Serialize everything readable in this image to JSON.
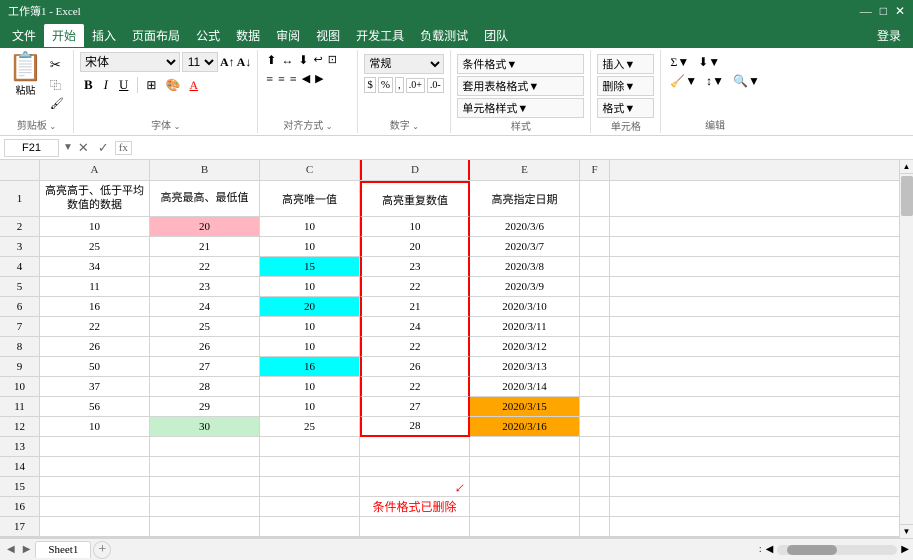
{
  "titleBar": {
    "text": "工作簿1 - Excel",
    "controls": [
      "—",
      "□",
      "✕"
    ]
  },
  "menuBar": {
    "items": [
      "文件",
      "开始",
      "插入",
      "页面布局",
      "公式",
      "数据",
      "审阅",
      "视图",
      "开发工具",
      "负载测试",
      "团队"
    ],
    "activeIndex": 1,
    "loginLabel": "登录"
  },
  "ribbon": {
    "clipboard": {
      "label": "剪贴板",
      "paste": "粘贴",
      "cut": "✂",
      "copy": "⿻",
      "formatpaint": "🖌"
    },
    "font": {
      "label": "字体",
      "name": "宋体",
      "size": "11",
      "growIcon": "A↑",
      "shrinkIcon": "A↓",
      "bold": "B",
      "italic": "I",
      "underline": "U",
      "border": "⊞",
      "fill": "🎨",
      "fontColor": "A"
    },
    "alignment": {
      "label": "对齐方式"
    },
    "number": {
      "label": "数字",
      "format": "常规"
    },
    "styles": {
      "label": "样式",
      "conditional": "条件格式▼",
      "tableStyle": "套用表格格式▼",
      "cellStyle": "单元格样式▼"
    },
    "cells": {
      "label": "单元格",
      "insert": "插入▼",
      "delete": "删除▼",
      "format": "格式▼"
    },
    "editing": {
      "label": "编辑",
      "sum": "Σ▼",
      "fill": "⬇▼",
      "clear": "🧹▼",
      "sort": "↕▼",
      "find": "🔍▼"
    }
  },
  "formulaBar": {
    "cellRef": "F21",
    "formula": ""
  },
  "columns": [
    {
      "label": "A",
      "class": "col-a"
    },
    {
      "label": "B",
      "class": "col-b"
    },
    {
      "label": "C",
      "class": "col-c"
    },
    {
      "label": "D",
      "class": "col-d"
    },
    {
      "label": "E",
      "class": "col-e"
    },
    {
      "label": "F",
      "class": "col-f"
    }
  ],
  "rows": [
    {
      "rowNum": "1",
      "heightClass": "row-h1",
      "cells": [
        {
          "value": "高亮高于、低于平均数值的数据",
          "bg": "",
          "colClass": "col-a"
        },
        {
          "value": "高亮最高、最低值",
          "bg": "",
          "colClass": "col-b"
        },
        {
          "value": "高亮唯一值",
          "bg": "",
          "colClass": "col-c"
        },
        {
          "value": "高亮重复数值",
          "bg": "",
          "colClass": "col-d",
          "dBorder": true
        },
        {
          "value": "高亮指定日期",
          "bg": "",
          "colClass": "col-e"
        },
        {
          "value": "",
          "bg": "",
          "colClass": "col-f"
        }
      ]
    },
    {
      "rowNum": "2",
      "heightClass": "row-h",
      "cells": [
        {
          "value": "10",
          "bg": "",
          "colClass": "col-a"
        },
        {
          "value": "20",
          "bg": "bg-pink",
          "colClass": "col-b"
        },
        {
          "value": "10",
          "bg": "",
          "colClass": "col-c"
        },
        {
          "value": "10",
          "bg": "",
          "colClass": "col-d",
          "dBorder": true
        },
        {
          "value": "2020/3/6",
          "bg": "",
          "colClass": "col-e"
        },
        {
          "value": "",
          "bg": "",
          "colClass": "col-f"
        }
      ]
    },
    {
      "rowNum": "3",
      "heightClass": "row-h",
      "cells": [
        {
          "value": "25",
          "bg": "",
          "colClass": "col-a"
        },
        {
          "value": "21",
          "bg": "",
          "colClass": "col-b"
        },
        {
          "value": "10",
          "bg": "",
          "colClass": "col-c"
        },
        {
          "value": "20",
          "bg": "",
          "colClass": "col-d",
          "dBorder": true
        },
        {
          "value": "2020/3/7",
          "bg": "",
          "colClass": "col-e"
        },
        {
          "value": "",
          "bg": "",
          "colClass": "col-f"
        }
      ]
    },
    {
      "rowNum": "4",
      "heightClass": "row-h",
      "cells": [
        {
          "value": "34",
          "bg": "",
          "colClass": "col-a"
        },
        {
          "value": "22",
          "bg": "",
          "colClass": "col-b"
        },
        {
          "value": "15",
          "bg": "bg-cyan",
          "colClass": "col-c"
        },
        {
          "value": "23",
          "bg": "",
          "colClass": "col-d",
          "dBorder": true
        },
        {
          "value": "2020/3/8",
          "bg": "",
          "colClass": "col-e"
        },
        {
          "value": "",
          "bg": "",
          "colClass": "col-f"
        }
      ]
    },
    {
      "rowNum": "5",
      "heightClass": "row-h",
      "cells": [
        {
          "value": "11",
          "bg": "",
          "colClass": "col-a"
        },
        {
          "value": "23",
          "bg": "",
          "colClass": "col-b"
        },
        {
          "value": "10",
          "bg": "",
          "colClass": "col-c"
        },
        {
          "value": "22",
          "bg": "",
          "colClass": "col-d",
          "dBorder": true
        },
        {
          "value": "2020/3/9",
          "bg": "",
          "colClass": "col-e"
        },
        {
          "value": "",
          "bg": "",
          "colClass": "col-f"
        }
      ]
    },
    {
      "rowNum": "6",
      "heightClass": "row-h",
      "cells": [
        {
          "value": "16",
          "bg": "",
          "colClass": "col-a"
        },
        {
          "value": "24",
          "bg": "",
          "colClass": "col-b"
        },
        {
          "value": "20",
          "bg": "bg-cyan",
          "colClass": "col-c"
        },
        {
          "value": "21",
          "bg": "",
          "colClass": "col-d",
          "dBorder": true
        },
        {
          "value": "2020/3/10",
          "bg": "",
          "colClass": "col-e"
        },
        {
          "value": "",
          "bg": "",
          "colClass": "col-f"
        }
      ]
    },
    {
      "rowNum": "7",
      "heightClass": "row-h",
      "cells": [
        {
          "value": "22",
          "bg": "",
          "colClass": "col-a"
        },
        {
          "value": "25",
          "bg": "",
          "colClass": "col-b"
        },
        {
          "value": "10",
          "bg": "",
          "colClass": "col-c"
        },
        {
          "value": "24",
          "bg": "",
          "colClass": "col-d",
          "dBorder": true
        },
        {
          "value": "2020/3/11",
          "bg": "",
          "colClass": "col-e"
        },
        {
          "value": "",
          "bg": "",
          "colClass": "col-f"
        }
      ]
    },
    {
      "rowNum": "8",
      "heightClass": "row-h",
      "cells": [
        {
          "value": "26",
          "bg": "",
          "colClass": "col-a"
        },
        {
          "value": "26",
          "bg": "",
          "colClass": "col-b"
        },
        {
          "value": "10",
          "bg": "",
          "colClass": "col-c"
        },
        {
          "value": "22",
          "bg": "",
          "colClass": "col-d",
          "dBorder": true
        },
        {
          "value": "2020/3/12",
          "bg": "",
          "colClass": "col-e"
        },
        {
          "value": "",
          "bg": "",
          "colClass": "col-f"
        }
      ]
    },
    {
      "rowNum": "9",
      "heightClass": "row-h",
      "cells": [
        {
          "value": "50",
          "bg": "",
          "colClass": "col-a"
        },
        {
          "value": "27",
          "bg": "",
          "colClass": "col-b"
        },
        {
          "value": "16",
          "bg": "bg-cyan",
          "colClass": "col-c"
        },
        {
          "value": "26",
          "bg": "",
          "colClass": "col-d",
          "dBorder": true
        },
        {
          "value": "2020/3/13",
          "bg": "",
          "colClass": "col-e"
        },
        {
          "value": "",
          "bg": "",
          "colClass": "col-f"
        }
      ]
    },
    {
      "rowNum": "10",
      "heightClass": "row-h",
      "cells": [
        {
          "value": "37",
          "bg": "",
          "colClass": "col-a"
        },
        {
          "value": "28",
          "bg": "",
          "colClass": "col-b"
        },
        {
          "value": "10",
          "bg": "",
          "colClass": "col-c"
        },
        {
          "value": "22",
          "bg": "",
          "colClass": "col-d",
          "dBorder": true
        },
        {
          "value": "2020/3/14",
          "bg": "",
          "colClass": "col-e"
        },
        {
          "value": "",
          "bg": "",
          "colClass": "col-f"
        }
      ]
    },
    {
      "rowNum": "11",
      "heightClass": "row-h",
      "cells": [
        {
          "value": "56",
          "bg": "",
          "colClass": "col-a"
        },
        {
          "value": "29",
          "bg": "",
          "colClass": "col-b"
        },
        {
          "value": "10",
          "bg": "",
          "colClass": "col-c"
        },
        {
          "value": "27",
          "bg": "",
          "colClass": "col-d",
          "dBorder": true
        },
        {
          "value": "2020/3/15",
          "bg": "bg-orange",
          "colClass": "col-e"
        },
        {
          "value": "",
          "bg": "",
          "colClass": "col-f"
        }
      ]
    },
    {
      "rowNum": "12",
      "heightClass": "row-h",
      "cells": [
        {
          "value": "10",
          "bg": "",
          "colClass": "col-a"
        },
        {
          "value": "30",
          "bg": "bg-light-green",
          "colClass": "col-b"
        },
        {
          "value": "25",
          "bg": "",
          "colClass": "col-c"
        },
        {
          "value": "28",
          "bg": "",
          "colClass": "col-d",
          "dBorder": true
        },
        {
          "value": "2020/3/16",
          "bg": "bg-orange",
          "colClass": "col-e"
        },
        {
          "value": "",
          "bg": "",
          "colClass": "col-f"
        }
      ]
    },
    {
      "rowNum": "13",
      "heightClass": "row-h",
      "cells": [
        {
          "value": "",
          "bg": "",
          "colClass": "col-a"
        },
        {
          "value": "",
          "bg": "",
          "colClass": "col-b"
        },
        {
          "value": "",
          "bg": "",
          "colClass": "col-c"
        },
        {
          "value": "",
          "bg": "",
          "colClass": "col-d",
          "dBorder": true
        },
        {
          "value": "",
          "bg": "",
          "colClass": "col-e"
        },
        {
          "value": "",
          "bg": "",
          "colClass": "col-f"
        }
      ]
    },
    {
      "rowNum": "14",
      "heightClass": "row-h",
      "cells": [
        {
          "value": "",
          "bg": "",
          "colClass": "col-a"
        },
        {
          "value": "",
          "bg": "",
          "colClass": "col-b"
        },
        {
          "value": "",
          "bg": "",
          "colClass": "col-c"
        },
        {
          "value": "",
          "bg": "",
          "colClass": "col-d"
        },
        {
          "value": "",
          "bg": "",
          "colClass": "col-e"
        },
        {
          "value": "",
          "bg": "",
          "colClass": "col-f"
        }
      ]
    },
    {
      "rowNum": "15",
      "heightClass": "row-h",
      "cells": [
        {
          "value": "",
          "bg": "",
          "colClass": "col-a"
        },
        {
          "value": "",
          "bg": "",
          "colClass": "col-b"
        },
        {
          "value": "",
          "bg": "",
          "colClass": "col-c"
        },
        {
          "value": "",
          "bg": "",
          "colClass": "col-d"
        },
        {
          "value": "",
          "bg": "",
          "colClass": "col-e"
        },
        {
          "value": "",
          "bg": "",
          "colClass": "col-f"
        }
      ]
    },
    {
      "rowNum": "16",
      "heightClass": "row-h",
      "cells": [
        {
          "value": "",
          "bg": "",
          "colClass": "col-a"
        },
        {
          "value": "",
          "bg": "",
          "colClass": "col-b"
        },
        {
          "value": "",
          "bg": "",
          "colClass": "col-c"
        },
        {
          "value": "",
          "bg": "",
          "colClass": "col-d"
        },
        {
          "value": "",
          "bg": "",
          "colClass": "col-e"
        },
        {
          "value": "",
          "bg": "",
          "colClass": "col-f"
        }
      ]
    },
    {
      "rowNum": "17",
      "heightClass": "row-h",
      "cells": [
        {
          "value": "",
          "bg": "",
          "colClass": "col-a"
        },
        {
          "value": "",
          "bg": "",
          "colClass": "col-b"
        },
        {
          "value": "",
          "bg": "",
          "colClass": "col-c"
        },
        {
          "value": "",
          "bg": "",
          "colClass": "col-d"
        },
        {
          "value": "",
          "bg": "",
          "colClass": "col-e"
        },
        {
          "value": "",
          "bg": "",
          "colClass": "col-f"
        }
      ]
    }
  ],
  "annotation": {
    "text": "条件格式已删除",
    "arrow": "↗"
  },
  "statusBar": {
    "sheetTab": "Sheet1",
    "addSheet": "+",
    "navLeft": "◀",
    "navRight": "▶"
  }
}
